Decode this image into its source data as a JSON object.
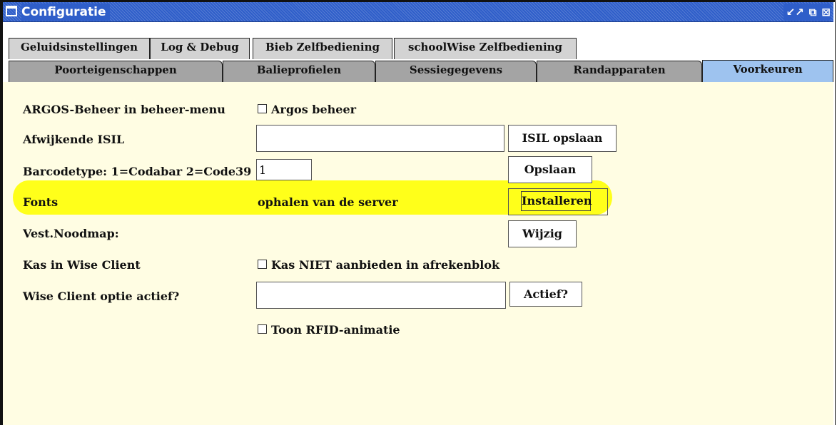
{
  "window": {
    "title": "Configuratie",
    "controls": [
      "restore-icon",
      "maximize-icon",
      "close-icon"
    ]
  },
  "tabs": {
    "row1": [
      "Geluidsinstellingen",
      "Log & Debug",
      "Bieb Zelfbediening",
      "schoolWise Zelfbediening"
    ],
    "row2": [
      "Poorteigenschappen",
      "Balieprofielen",
      "Sessiegegevens",
      "Randapparaten",
      "Voorkeuren"
    ],
    "active": "Voorkeuren"
  },
  "form": {
    "argos": {
      "label": "ARGOS-Beheer in beheer-menu",
      "checkbox_label": "Argos beheer",
      "checked": false
    },
    "isil": {
      "label": "Afwijkende ISIL",
      "value": "",
      "button": "ISIL opslaan"
    },
    "barcode": {
      "label": "Barcodetype: 1=Codabar 2=Code39",
      "value": "1",
      "button": "Opslaan"
    },
    "fonts": {
      "label": "Fonts",
      "text": "ophalen van de server",
      "button": "Installeren"
    },
    "noodmap": {
      "label": "Vest.Noodmap:",
      "button": "Wijzig"
    },
    "kas": {
      "label": "Kas in Wise Client",
      "checkbox_label": "Kas NIET aanbieden in afrekenblok",
      "checked": false
    },
    "wise_option": {
      "label": "Wise Client optie actief?",
      "value": "",
      "button": "Actief?"
    },
    "rfid": {
      "checkbox_label": "Toon RFID-animatie",
      "checked": false
    }
  },
  "colors": {
    "titlebar": "#2f5ec9",
    "panel": "#fffde3",
    "highlight": "#ffff1a",
    "active_tab": "#9ec3ef"
  }
}
